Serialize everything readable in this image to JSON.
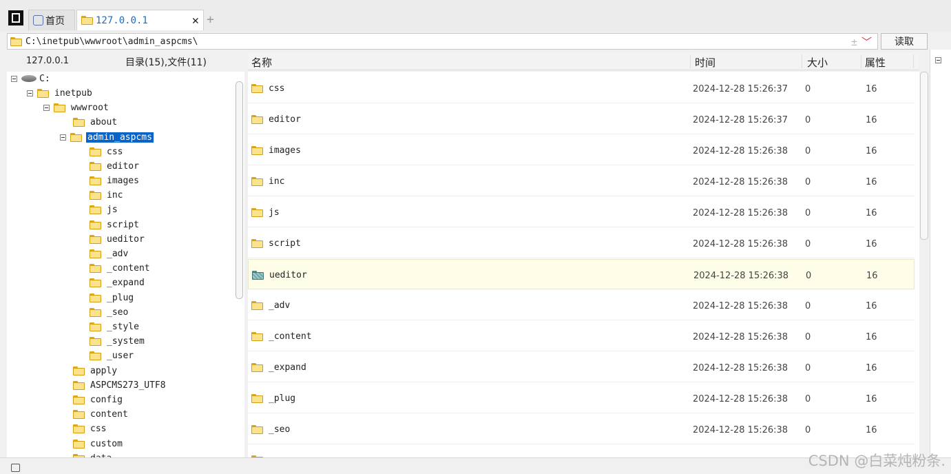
{
  "tabs": {
    "home_label": "首页",
    "host_label": "127.0.0.1",
    "close_glyph": "✕",
    "add_glyph": "+"
  },
  "path_bar": {
    "path": "C:\\inetpub\\wwwroot\\admin_aspcms\\",
    "dropdown_glyph": "±",
    "chevron_glyph": "﹀",
    "read_button_label": "读取"
  },
  "left_pane": {
    "host": "127.0.0.1",
    "dir_count": "目录(15),文件(11)"
  },
  "tree": {
    "drive": "C:",
    "inetpub": "inetpub",
    "wwwroot": "wwwroot",
    "about": "about",
    "admin_aspcms": "admin_aspcms",
    "children": [
      "css",
      "editor",
      "images",
      "inc",
      "js",
      "script",
      "ueditor",
      "_adv",
      "_content",
      "_expand",
      "_plug",
      "_seo",
      "_style",
      "_system",
      "_user"
    ],
    "siblings": [
      "apply",
      "ASPCMS273_UTF8",
      "config",
      "content",
      "css",
      "custom",
      "data"
    ]
  },
  "list_header": {
    "name": "名称",
    "time": "时间",
    "size": "大小",
    "attr": "属性"
  },
  "files": [
    {
      "name": "css",
      "time": "2024-12-28 15:26:37",
      "size": "0",
      "attr": "16"
    },
    {
      "name": "editor",
      "time": "2024-12-28 15:26:37",
      "size": "0",
      "attr": "16"
    },
    {
      "name": "images",
      "time": "2024-12-28 15:26:38",
      "size": "0",
      "attr": "16"
    },
    {
      "name": "inc",
      "time": "2024-12-28 15:26:38",
      "size": "0",
      "attr": "16"
    },
    {
      "name": "js",
      "time": "2024-12-28 15:26:38",
      "size": "0",
      "attr": "16"
    },
    {
      "name": "script",
      "time": "2024-12-28 15:26:38",
      "size": "0",
      "attr": "16"
    },
    {
      "name": "ueditor",
      "time": "2024-12-28 15:26:38",
      "size": "0",
      "attr": "16"
    },
    {
      "name": "_adv",
      "time": "2024-12-28 15:26:38",
      "size": "0",
      "attr": "16"
    },
    {
      "name": "_content",
      "time": "2024-12-28 15:26:38",
      "size": "0",
      "attr": "16"
    },
    {
      "name": "_expand",
      "time": "2024-12-28 15:26:38",
      "size": "0",
      "attr": "16"
    },
    {
      "name": "_plug",
      "time": "2024-12-28 15:26:38",
      "size": "0",
      "attr": "16"
    },
    {
      "name": "_seo",
      "time": "2024-12-28 15:26:38",
      "size": "0",
      "attr": "16"
    }
  ],
  "watermark": "CSDN @白菜炖粉条.",
  "colors": {
    "selection": "#0a64c8",
    "tab_active_text": "#1b6bbf",
    "folder_fill": "#fbe38c",
    "highlight_row": "#fdfde8"
  },
  "icons": {
    "app_logo": "app-logo-icon",
    "home_tab": "home-icon",
    "folder": "folder-icon",
    "drive": "drive-icon",
    "status": "window-icon"
  }
}
